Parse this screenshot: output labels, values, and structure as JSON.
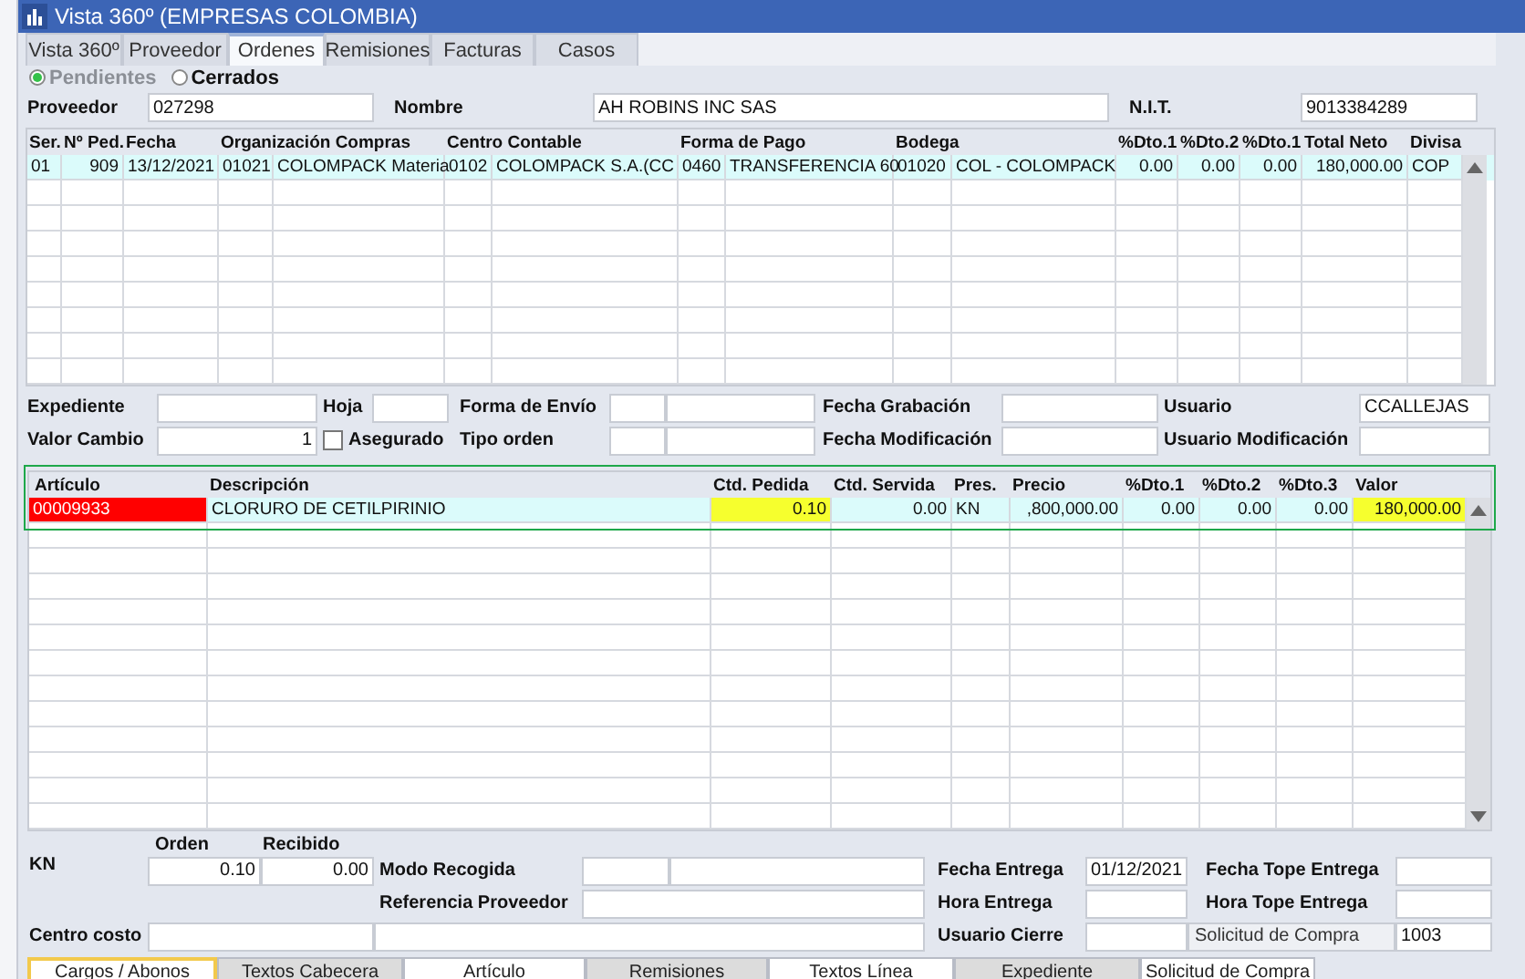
{
  "window": {
    "title": "Vista 360º (EMPRESAS COLOMBIA)"
  },
  "tabs": [
    {
      "label": "Vista 360º",
      "selected": false
    },
    {
      "label": "Proveedor",
      "selected": false
    },
    {
      "label": "Ordenes",
      "selected": true
    },
    {
      "label": "Remisiones",
      "selected": false
    },
    {
      "label": "Facturas",
      "selected": false
    },
    {
      "label": "Casos",
      "selected": false
    }
  ],
  "filter": [
    {
      "label": "Pendientes",
      "selected": true
    },
    {
      "label": "Cerrados",
      "selected": false
    }
  ],
  "supplier": {
    "proveedor_label": "Proveedor",
    "proveedor": "027298",
    "nombre_label": "Nombre",
    "nombre": "AH ROBINS INC SAS",
    "nit_label": "N.I.T.",
    "nit": "9013384289"
  },
  "orders": {
    "columns": [
      "Ser.",
      "Nº Ped.",
      "Fecha",
      "Organización Compras",
      "Centro Contable",
      "Forma de Pago",
      "Bodega",
      "%Dto.1",
      "%Dto.2",
      "%Dto.1",
      "Total Neto",
      "Divisa"
    ],
    "rows": [
      {
        "selected": true,
        "cells": [
          {
            "text": "01"
          },
          {
            "text": "909"
          },
          {
            "text": "13/12/2021"
          },
          {
            "code": "01021",
            "name": "COLOMPACK Materia"
          },
          {
            "code": "0102",
            "name": "COLOMPACK S.A.(CC"
          },
          {
            "code": "0460",
            "name": "TRANSFERENCIA 60"
          },
          {
            "code": "01020",
            "name": "COL - COLOMPACK"
          },
          {
            "text": "0.00"
          },
          {
            "text": "0.00"
          },
          {
            "text": "0.00"
          },
          {
            "text": "180,000.00"
          },
          {
            "text": "COP"
          }
        ]
      }
    ]
  },
  "order_details": {
    "expediente": {
      "label": "Expediente"
    },
    "hoja": {
      "label": "Hoja"
    },
    "forma_envio": {
      "label": "Forma de Envío"
    },
    "fecha_grabacion": {
      "label": "Fecha Grabación"
    },
    "usuario": {
      "label": "Usuario",
      "value": "CCALLEJAS"
    },
    "valor_cambio": {
      "label": "Valor Cambio",
      "value": "1"
    },
    "asegurado": {
      "label": "Asegurado",
      "checked": false
    },
    "tipo_orden": {
      "label": "Tipo orden"
    },
    "fecha_modificacion": {
      "label": "Fecha Modificación"
    },
    "usuario_modificacion": {
      "label": "Usuario Modificación"
    }
  },
  "items": {
    "columns": [
      "Artículo",
      "Descripción",
      "Ctd. Pedida",
      "Ctd. Servida",
      "Pres.",
      "Precio",
      "%Dto.1",
      "%Dto.2",
      "%Dto.3",
      "Valor"
    ],
    "rows": [
      {
        "selected": true,
        "cells": [
          {
            "text": "00009933",
            "color": "#ff0000"
          },
          {
            "text": "CLORURO DE CETILPIRINIO"
          },
          {
            "text": "0.10",
            "color": "#f6ff2e"
          },
          {
            "text": "0.00"
          },
          {
            "text": "KN"
          },
          {
            "text": ",800,000.00"
          },
          {
            "text": "0.00"
          },
          {
            "text": "0.00"
          },
          {
            "text": "0.00"
          },
          {
            "text": "180,000.00",
            "color": "#f6ff2e"
          }
        ]
      }
    ]
  },
  "line_details": {
    "unit": "KN",
    "orden": {
      "label": "Orden",
      "value": "0.10"
    },
    "recibido": {
      "label": "Recibido",
      "value": "0.00"
    },
    "modo_recogida": {
      "label": "Modo Recogida"
    },
    "referencia_proveedor": {
      "label": "Referencia Proveedor"
    },
    "centro_costo": {
      "label": "Centro costo"
    },
    "fecha_entrega": {
      "label": "Fecha Entrega",
      "value": "01/12/2021"
    },
    "hora_entrega": {
      "label": "Hora Entrega"
    },
    "usuario_cierre": {
      "label": "Usuario Cierre"
    },
    "fecha_tope_entrega": {
      "label": "Fecha Tope Entrega"
    },
    "hora_tope_entrega": {
      "label": "Hora Tope Entrega"
    },
    "solicitud_compra": {
      "label": "Solicitud de Compra",
      "value": "1003"
    }
  },
  "bottom_tabs": [
    {
      "label": "Cargos / Abonos",
      "selected": true
    },
    {
      "label": "Textos Cabecera",
      "selected": false
    },
    {
      "label": "Artículo",
      "selected": false
    },
    {
      "label": "Remisiones",
      "selected": false
    },
    {
      "label": "Textos Línea",
      "selected": false
    },
    {
      "label": "Expediente",
      "selected": false
    },
    {
      "label": "Solicitud de Compra",
      "selected": false
    }
  ]
}
